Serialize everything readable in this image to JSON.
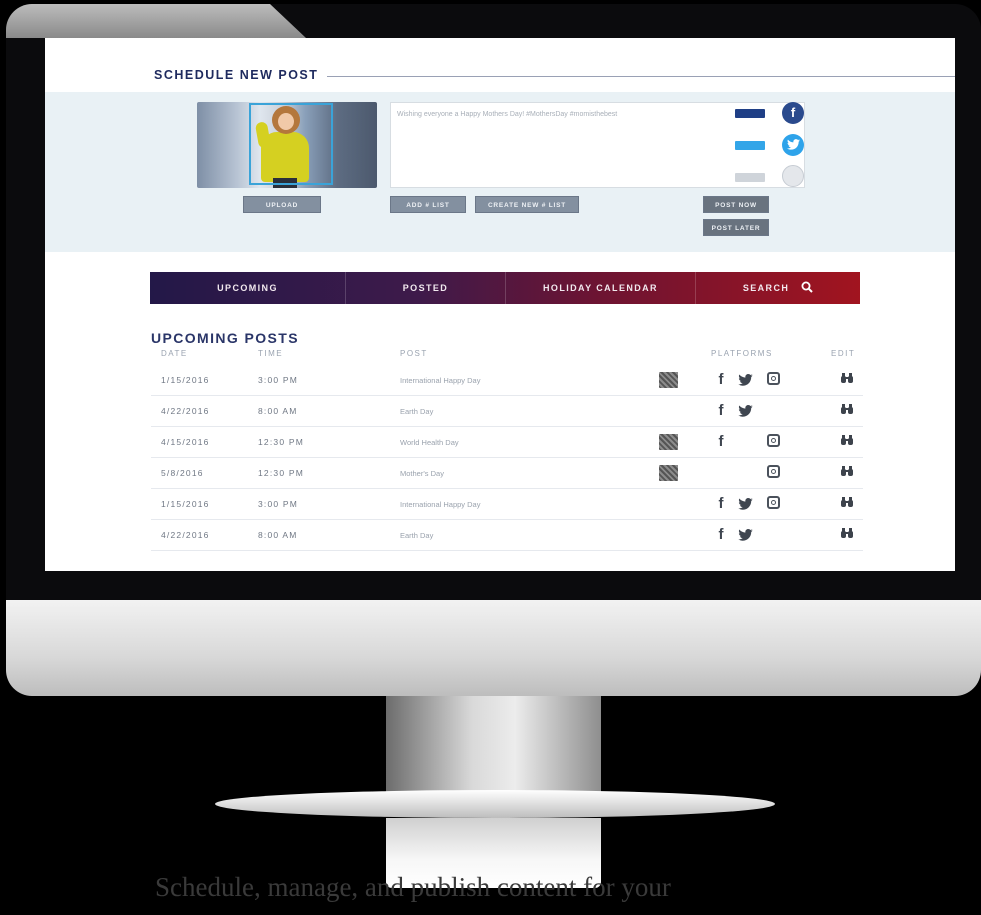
{
  "tagline": "Schedule, manage, and publish content for your",
  "composer": {
    "section_title": "SCHEDULE NEW POST",
    "post_text": "Wishing everyone a Happy Mothers Day! #MothersDay #momisthebest",
    "upload_label": "UPLOAD",
    "add_list_label": "ADD # LIST",
    "create_list_label": "CREATE NEW # LIST",
    "post_now_label": "POST NOW",
    "post_later_label": "POST LATER",
    "platforms": [
      {
        "name": "facebook",
        "glyph": "f",
        "color": "#2a4a8d",
        "toggle_color": "#1f3f86",
        "enabled": true
      },
      {
        "name": "twitter",
        "glyph": "t",
        "color": "#2ea3ea",
        "toggle_color": "#33a5e8",
        "enabled": true
      },
      {
        "name": "instagram",
        "glyph": "◎",
        "color": "#d7dbe0",
        "toggle_color": "#cfd4da",
        "enabled": false
      }
    ]
  },
  "nav": {
    "tabs": [
      {
        "label": "UPCOMING"
      },
      {
        "label": "POSTED"
      },
      {
        "label": "HOLIDAY CALENDAR"
      },
      {
        "label": "SEARCH"
      }
    ]
  },
  "table": {
    "title": "UPCOMING POSTS",
    "headers": {
      "date": "DATE",
      "time": "TIME",
      "post": "POST",
      "platforms": "PLATFORMS",
      "edit": "EDIT"
    },
    "rows": [
      {
        "date": "1/15/2016",
        "time": "3:00 PM",
        "post": "International Happy Day",
        "image": true,
        "facebook": true,
        "twitter": true,
        "instagram": true
      },
      {
        "date": "4/22/2016",
        "time": "8:00 AM",
        "post": "Earth Day",
        "image": false,
        "facebook": true,
        "twitter": true,
        "instagram": false
      },
      {
        "date": "4/15/2016",
        "time": "12:30 PM",
        "post": "World Health Day",
        "image": true,
        "facebook": true,
        "twitter": false,
        "instagram": true
      },
      {
        "date": "5/8/2016",
        "time": "12:30 PM",
        "post": "Mother's Day",
        "image": true,
        "facebook": false,
        "twitter": false,
        "instagram": true
      },
      {
        "date": "1/15/2016",
        "time": "3:00 PM",
        "post": "International Happy Day",
        "image": false,
        "facebook": true,
        "twitter": true,
        "instagram": true
      },
      {
        "date": "4/22/2016",
        "time": "8:00 AM",
        "post": "Earth Day",
        "image": false,
        "facebook": true,
        "twitter": true,
        "instagram": false
      }
    ]
  },
  "colors": {
    "nav_start": "#231848",
    "nav_end": "#a1141f",
    "heading": "#2a3568"
  }
}
